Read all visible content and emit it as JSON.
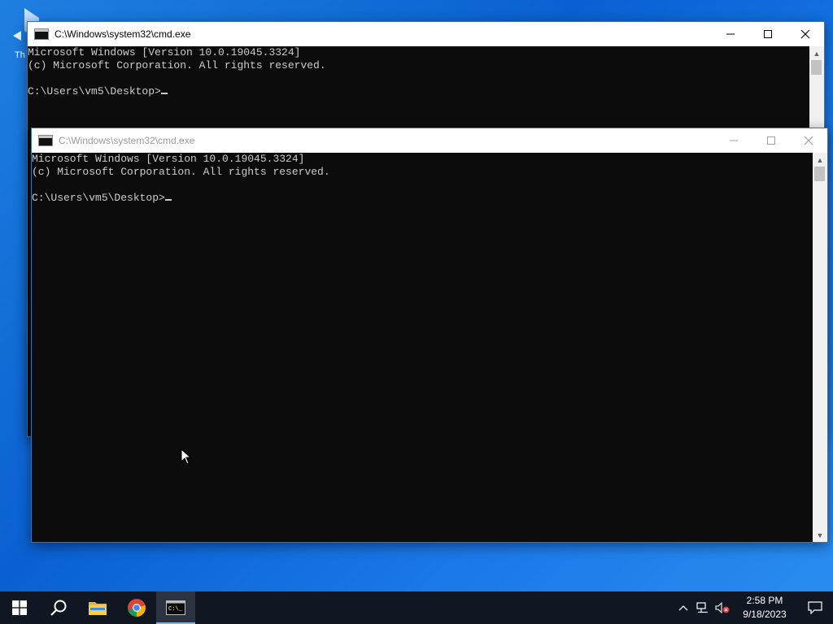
{
  "desktop": {
    "icon_label_partial": "Th"
  },
  "windows": [
    {
      "title": "C:\\Windows\\system32\\cmd.exe",
      "state": "active",
      "lines": [
        "Microsoft Windows [Version 10.0.19045.3324]",
        "(c) Microsoft Corporation. All rights reserved.",
        "",
        "C:\\Users\\vm5\\Desktop>"
      ]
    },
    {
      "title": "C:\\Windows\\system32\\cmd.exe",
      "state": "inactive",
      "lines": [
        "Microsoft Windows [Version 10.0.19045.3324]",
        "(c) Microsoft Corporation. All rights reserved.",
        "",
        "C:\\Users\\vm5\\Desktop>"
      ]
    }
  ],
  "taskbar": {
    "items": [
      "windows-start-icon",
      "search-icon",
      "file-explorer-icon",
      "chrome-icon",
      "command-prompt-icon"
    ],
    "active_item": "command-prompt-icon",
    "tray": {
      "icons": [
        "chevron-up-icon",
        "network-icon",
        "volume-muted-icon"
      ],
      "time": "2:58 PM",
      "date": "9/18/2023"
    }
  },
  "colors": {
    "console_bg": "#0c0c0c",
    "console_text": "#cccccc",
    "taskbar_bg": "#101722",
    "desktop_blue": "#0a60d0"
  }
}
